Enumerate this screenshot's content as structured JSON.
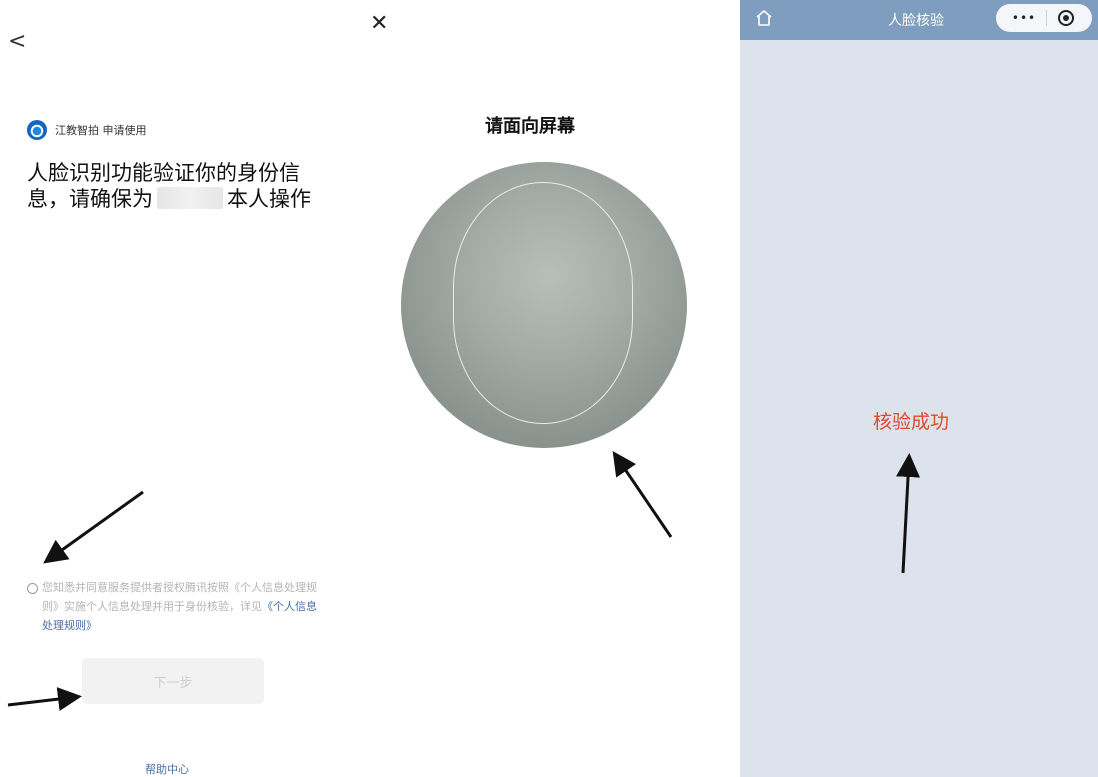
{
  "left": {
    "back_glyph": "<",
    "app_name": "江教智拍 申请使用",
    "headline_part1": "人脸识别功能验证你的身份信息，请确保为",
    "headline_part2": "本人操作",
    "consent_text": "您知悉并同意服务提供者授权腾讯按照《个人信息处理规则》实施个人信息处理并用于身份核验，详见",
    "consent_link": "《个人信息处理规则》",
    "next_button": "下一步",
    "help_link": "帮助中心"
  },
  "middle": {
    "close_glyph": "✕",
    "prompt": "请面向屏幕"
  },
  "right": {
    "title": "人脸核验",
    "more_glyph": "•••",
    "result": "核验成功"
  },
  "colors": {
    "topbar": "#7e9dbf",
    "right_bg": "#dce3ec",
    "success": "#e24a2c",
    "link": "#4a6fa5"
  },
  "icons": [
    "chevron-left-icon",
    "close-icon",
    "home-icon",
    "more-icon",
    "target-icon",
    "app-logo-icon"
  ]
}
